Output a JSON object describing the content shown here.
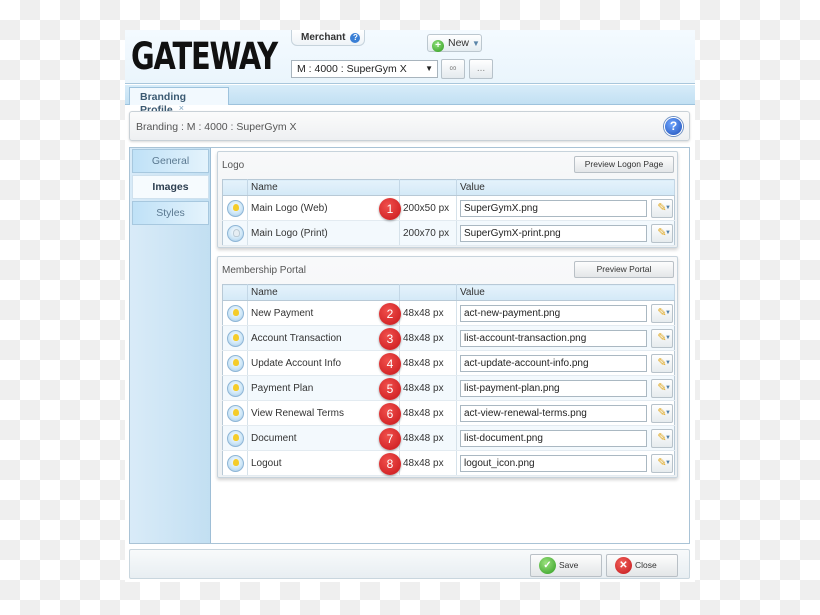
{
  "header": {
    "logo": "GATEWAY",
    "merchant_label": "Merchant",
    "merchant_help_icon": "?",
    "new_button": "New",
    "merchant_select_value": "M : 4000 : SuperGym X",
    "link_button_icon": "∞",
    "more_button": "..."
  },
  "tabs": [
    {
      "label": "Branding Profile",
      "close": "×"
    }
  ],
  "titlebar": {
    "title": "Branding : M : 4000 : SuperGym X",
    "help": "?"
  },
  "sidenav": {
    "items": [
      {
        "label": "General",
        "active": false
      },
      {
        "label": "Images",
        "active": true
      },
      {
        "label": "Styles",
        "active": false
      }
    ]
  },
  "logo_section": {
    "title": "Logo",
    "preview_button": "Preview Logon Page",
    "columns": [
      "",
      "Name",
      "",
      "Value"
    ],
    "rows": [
      {
        "enabled": true,
        "name": "Main Logo (Web)",
        "badge": "1",
        "size": "200x50 px",
        "value": "SuperGymX.png"
      },
      {
        "enabled": false,
        "name": "Main Logo (Print)",
        "badge": "",
        "size": "200x70 px",
        "value": "SuperGymX-print.png"
      }
    ]
  },
  "portal_section": {
    "title": "Membership Portal",
    "preview_button": "Preview Portal",
    "columns": [
      "",
      "Name",
      "",
      "Value"
    ],
    "rows": [
      {
        "enabled": true,
        "name": "New Payment",
        "badge": "2",
        "size": "48x48 px",
        "value": "act-new-payment.png"
      },
      {
        "enabled": true,
        "name": "Account Transaction",
        "badge": "3",
        "size": "48x48 px",
        "value": "list-account-transaction.png"
      },
      {
        "enabled": true,
        "name": "Update Account Info",
        "badge": "4",
        "size": "48x48 px",
        "value": "act-update-account-info.png"
      },
      {
        "enabled": true,
        "name": "Payment Plan",
        "badge": "5",
        "size": "48x48 px",
        "value": "list-payment-plan.png"
      },
      {
        "enabled": true,
        "name": "View Renewal Terms",
        "badge": "6",
        "size": "48x48 px",
        "value": "act-view-renewal-terms.png"
      },
      {
        "enabled": true,
        "name": "Document",
        "badge": "7",
        "size": "48x48 px",
        "value": "list-document.png"
      },
      {
        "enabled": true,
        "name": "Logout",
        "badge": "8",
        "size": "48x48 px",
        "value": "logout_icon.png"
      }
    ]
  },
  "footer": {
    "save": "Save",
    "close": "Close"
  }
}
